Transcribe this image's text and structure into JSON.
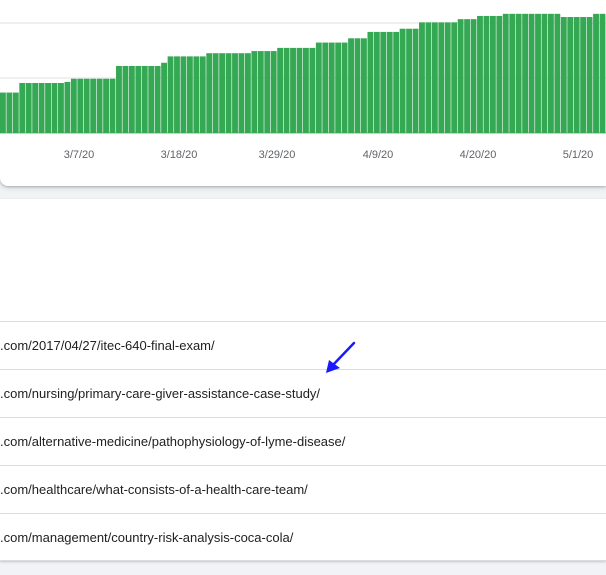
{
  "chart_data": {
    "type": "bar",
    "color": "#34a853",
    "x_tick_labels": [
      "3/7/20",
      "3/18/20",
      "3/29/20",
      "4/9/20",
      "4/20/20",
      "5/1/20"
    ],
    "values": [
      38,
      38,
      38,
      47,
      47,
      47,
      47,
      47,
      47,
      47,
      48,
      51,
      51,
      51,
      51,
      51,
      51,
      51,
      63,
      63,
      63,
      63,
      63,
      63,
      63,
      66,
      72,
      72,
      72,
      72,
      72,
      72,
      75,
      75,
      75,
      75,
      75,
      75,
      75,
      77,
      77,
      77,
      77,
      80,
      80,
      80,
      80,
      80,
      80,
      85,
      85,
      85,
      85,
      85,
      89,
      89,
      89,
      95,
      95,
      95,
      95,
      95,
      98,
      98,
      98,
      104,
      104,
      104,
      104,
      104,
      104,
      107,
      107,
      107,
      110,
      110,
      110,
      110,
      112,
      112,
      112,
      112,
      112,
      112,
      112,
      112,
      112,
      109,
      109,
      109,
      109,
      109,
      112,
      112
    ],
    "ylim": [
      0,
      125
    ]
  },
  "url_table": {
    "rows": [
      ".com/2017/04/27/itec-640-final-exam/",
      ".com/nursing/primary-care-giver-assistance-case-study/",
      ".com/alternative-medicine/pathophysiology-of-lyme-disease/",
      ".com/healthcare/what-consists-of-a-health-care-team/",
      ".com/management/country-risk-analysis-coca-cola/"
    ]
  },
  "annotation": {
    "arrow_color": "#1a1aff"
  }
}
